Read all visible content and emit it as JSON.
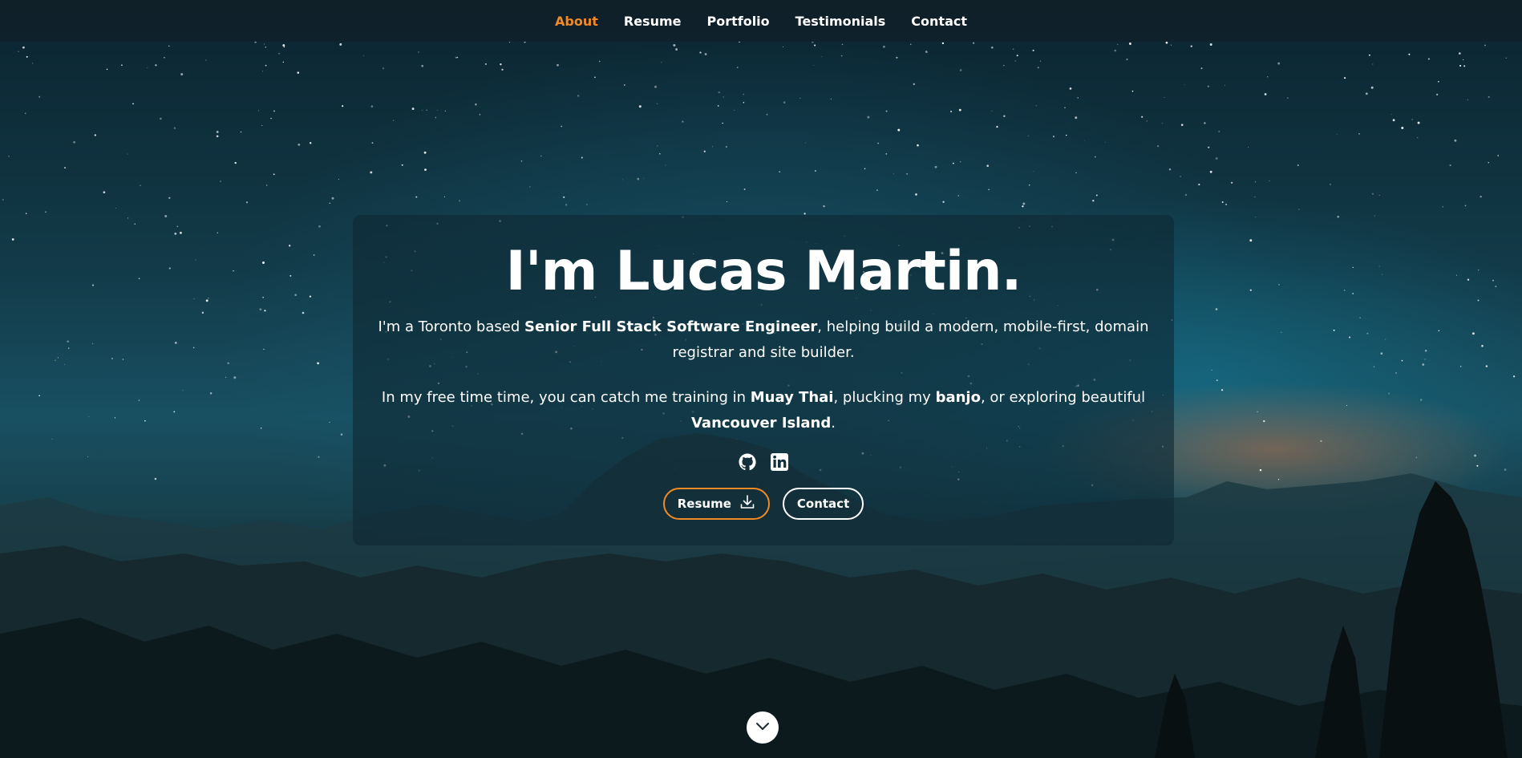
{
  "nav": {
    "items": [
      {
        "label": "About",
        "active": true
      },
      {
        "label": "Resume",
        "active": false
      },
      {
        "label": "Portfolio",
        "active": false
      },
      {
        "label": "Testimonials",
        "active": false
      },
      {
        "label": "Contact",
        "active": false
      }
    ],
    "active_color": "#f08a24"
  },
  "hero": {
    "title": "I'm Lucas Martin.",
    "intro": {
      "t1": "I'm a Toronto based ",
      "b1": "Senior Full Stack Software Engineer",
      "t2": ", helping build a modern, mobile-first, domain registrar and site builder."
    },
    "hobbies": {
      "t1": "In my free time time, you can catch me training in ",
      "b1": "Muay Thai",
      "t2": ", plucking my ",
      "b2": "banjo",
      "t3": ", or exploring beautiful ",
      "b3": "Vancouver Island",
      "t4": "."
    },
    "socials": [
      {
        "icon": "github-icon"
      },
      {
        "icon": "linkedin-icon"
      }
    ],
    "buttons": {
      "resume_label": "Resume",
      "resume_icon": "download-icon",
      "contact_label": "Contact"
    }
  },
  "scroll_icon": "chevron-down-icon"
}
